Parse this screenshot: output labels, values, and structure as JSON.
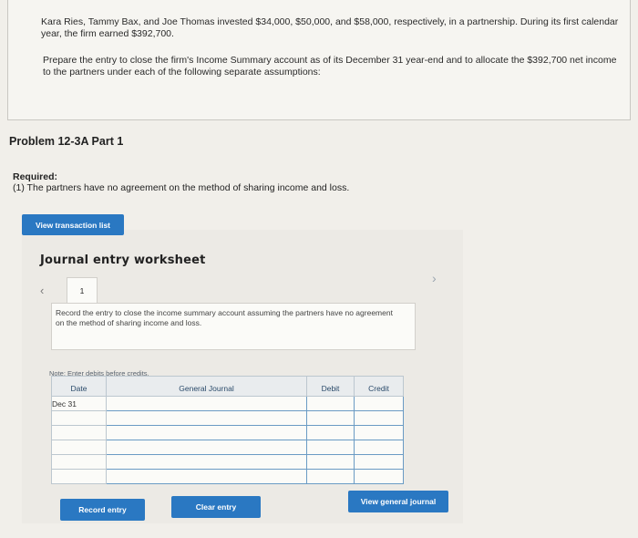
{
  "problem_intro": {
    "paragraph1": "Kara Ries, Tammy Bax, and Joe Thomas invested $34,000, $50,000, and $58,000, respectively, in a partnership. During its first calendar year, the firm earned $392,700.",
    "paragraph2": "Prepare the entry to close the firm's Income Summary account as of its December 31 year-end and to allocate the $392,700 net income to the partners under each of the following separate assumptions:"
  },
  "problem_title": "Problem 12-3A Part 1",
  "required": {
    "label": "Required:",
    "text": "(1) The partners have no agreement on the method of sharing income and loss."
  },
  "view_transaction_list_label": "View transaction list",
  "worksheet": {
    "title": "Journal entry worksheet",
    "active_tab": "1",
    "instruction": "Record the entry to close the income summary account assuming the partners have no agreement on the method of sharing income and loss.",
    "note": "Note: Enter debits before credits.",
    "table": {
      "headers": {
        "date": "Date",
        "account": "General Journal",
        "debit": "Debit",
        "credit": "Credit"
      },
      "rows": [
        {
          "date": "Dec 31",
          "account": "",
          "debit": "",
          "credit": ""
        },
        {
          "date": "",
          "account": "",
          "debit": "",
          "credit": ""
        },
        {
          "date": "",
          "account": "",
          "debit": "",
          "credit": ""
        },
        {
          "date": "",
          "account": "",
          "debit": "",
          "credit": ""
        },
        {
          "date": "",
          "account": "",
          "debit": "",
          "credit": ""
        },
        {
          "date": "",
          "account": "",
          "debit": "",
          "credit": ""
        }
      ]
    },
    "buttons": {
      "record_entry": "Record entry",
      "clear_entry": "Clear entry",
      "view_general_journal": "View general journal"
    }
  },
  "colors": {
    "button_blue": "#2a78c2",
    "page_background": "#f1efea",
    "input_border": "#6a9bc4"
  }
}
